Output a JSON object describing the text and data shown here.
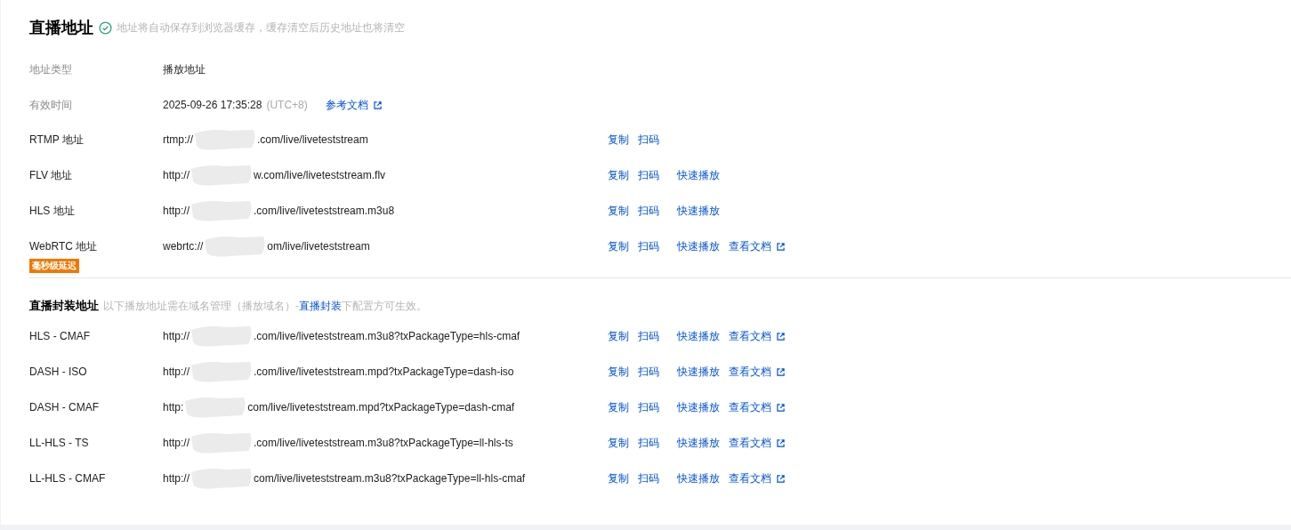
{
  "section": {
    "title": "直播地址",
    "note": "地址将自动保存到浏览器缓存，缓存清空后历史地址也将清空"
  },
  "info_rows": [
    {
      "label": "地址类型",
      "value": "播放地址"
    },
    {
      "label": "有效时间",
      "value": "2025-09-26 17:35:28",
      "suffix": "(UTC+8)",
      "link": "参考文档"
    }
  ],
  "address_rows": [
    {
      "label": "RTMP 地址",
      "url_start": "rtmp://",
      "url_end": ".com/live/liveteststream",
      "actions": [
        {
          "kind": "link",
          "label": "复制"
        },
        {
          "kind": "link",
          "label": "扫码"
        }
      ]
    },
    {
      "label": "FLV 地址",
      "url_start": "http://",
      "url_end": "w.com/live/liveteststream.flv",
      "actions": [
        {
          "kind": "link",
          "label": "复制"
        },
        {
          "kind": "link",
          "label": "扫码"
        },
        {
          "kind": "link",
          "label": "快速播放"
        }
      ]
    },
    {
      "label": "HLS 地址",
      "url_start": "http://",
      "url_end": ".com/live/liveteststream.m3u8",
      "actions": [
        {
          "kind": "link",
          "label": "复制"
        },
        {
          "kind": "link",
          "label": "扫码"
        },
        {
          "kind": "link",
          "label": "快速播放"
        }
      ]
    },
    {
      "label": "WebRTC 地址",
      "badge": "毫秒级延迟",
      "url_start": "webrtc://",
      "url_end": "om/live/liveteststream",
      "actions": [
        {
          "kind": "link",
          "label": "复制"
        },
        {
          "kind": "link",
          "label": "扫码"
        },
        {
          "kind": "link",
          "label": "快速播放"
        },
        {
          "kind": "doc",
          "label": "查看文档"
        }
      ]
    }
  ],
  "package_section": {
    "title": "直播封装地址",
    "note_before": "以下播放地址需在域名管理（播放域名）-",
    "note_link": "直播封装",
    "note_after": "下配置方可生效。"
  },
  "package_rows": [
    {
      "label": "HLS - CMAF",
      "url_start": "http://",
      "url_end": ".com/live/liveteststream.m3u8?txPackageType=hls-cmaf",
      "actions": [
        {
          "kind": "link",
          "label": "复制"
        },
        {
          "kind": "link",
          "label": "扫码"
        },
        {
          "kind": "link",
          "label": "快速播放"
        },
        {
          "kind": "doc",
          "label": "查看文档"
        }
      ]
    },
    {
      "label": "DASH - ISO",
      "url_start": "http://",
      "url_end": ".com/live/liveteststream.mpd?txPackageType=dash-iso",
      "actions": [
        {
          "kind": "link",
          "label": "复制"
        },
        {
          "kind": "link",
          "label": "扫码"
        },
        {
          "kind": "link",
          "label": "快速播放"
        },
        {
          "kind": "doc",
          "label": "查看文档"
        }
      ]
    },
    {
      "label": "DASH - CMAF",
      "url_start": "http:",
      "url_end": "com/live/liveteststream.mpd?txPackageType=dash-cmaf",
      "actions": [
        {
          "kind": "link",
          "label": "复制"
        },
        {
          "kind": "link",
          "label": "扫码"
        },
        {
          "kind": "link",
          "label": "快速播放"
        },
        {
          "kind": "doc",
          "label": "查看文档"
        }
      ]
    },
    {
      "label": "LL-HLS - TS",
      "url_start": "http://",
      "url_end": ".com/live/liveteststream.m3u8?txPackageType=ll-hls-ts",
      "actions": [
        {
          "kind": "link",
          "label": "复制"
        },
        {
          "kind": "link",
          "label": "扫码"
        },
        {
          "kind": "link",
          "label": "快速播放"
        },
        {
          "kind": "doc",
          "label": "查看文档"
        }
      ]
    },
    {
      "label": "LL-HLS - CMAF",
      "url_start": "http://",
      "url_end": "com/live/liveteststream.m3u8?txPackageType=ll-hls-cmaf",
      "actions": [
        {
          "kind": "link",
          "label": "复制"
        },
        {
          "kind": "link",
          "label": "扫码"
        },
        {
          "kind": "link",
          "label": "快速播放"
        },
        {
          "kind": "doc",
          "label": "查看文档"
        }
      ]
    }
  ]
}
